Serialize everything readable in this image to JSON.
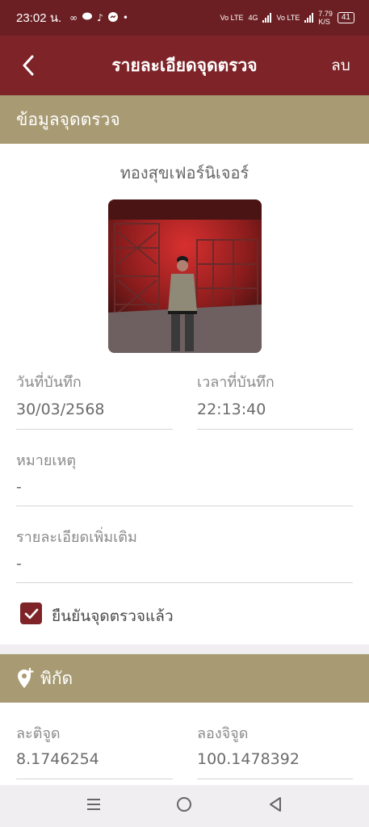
{
  "status_bar": {
    "time": "23:02 น.",
    "notifications": [
      "∞",
      "line",
      "tiktok",
      "messenger",
      "•"
    ],
    "network_1": "Vo LTE",
    "network_2": "4G",
    "network_3": "Vo LTE",
    "speed": "7.79",
    "speed_unit": "K/S",
    "battery": "41"
  },
  "header": {
    "title": "รายละเอียดจุดตรวจ",
    "delete_label": "ลบ"
  },
  "section_checkpoint": {
    "title": "ข้อมูลจุดตรวจ",
    "place_name": "ทองสุขเฟอร์นิเจอร์",
    "date_label": "วันที่บันทึก",
    "date_value": "30/03/2568",
    "time_label": "เวลาที่บันทึก",
    "time_value": "22:13:40",
    "note_label": "หมายเหตุ",
    "note_value": "-",
    "detail_label": "รายละเอียดเพิ่มเติม",
    "detail_value": "-",
    "confirm_label": "ยืนยันจุดตรวจแล้ว",
    "confirmed": true
  },
  "section_location": {
    "title": "พิกัด",
    "lat_label": "ละติจูด",
    "lat_value": "8.1746254",
    "lng_label": "ลองจิจูด",
    "lng_value": "100.1478392"
  },
  "colors": {
    "primary": "#7e2428",
    "status": "#6b1f23",
    "section": "#a89b74"
  }
}
